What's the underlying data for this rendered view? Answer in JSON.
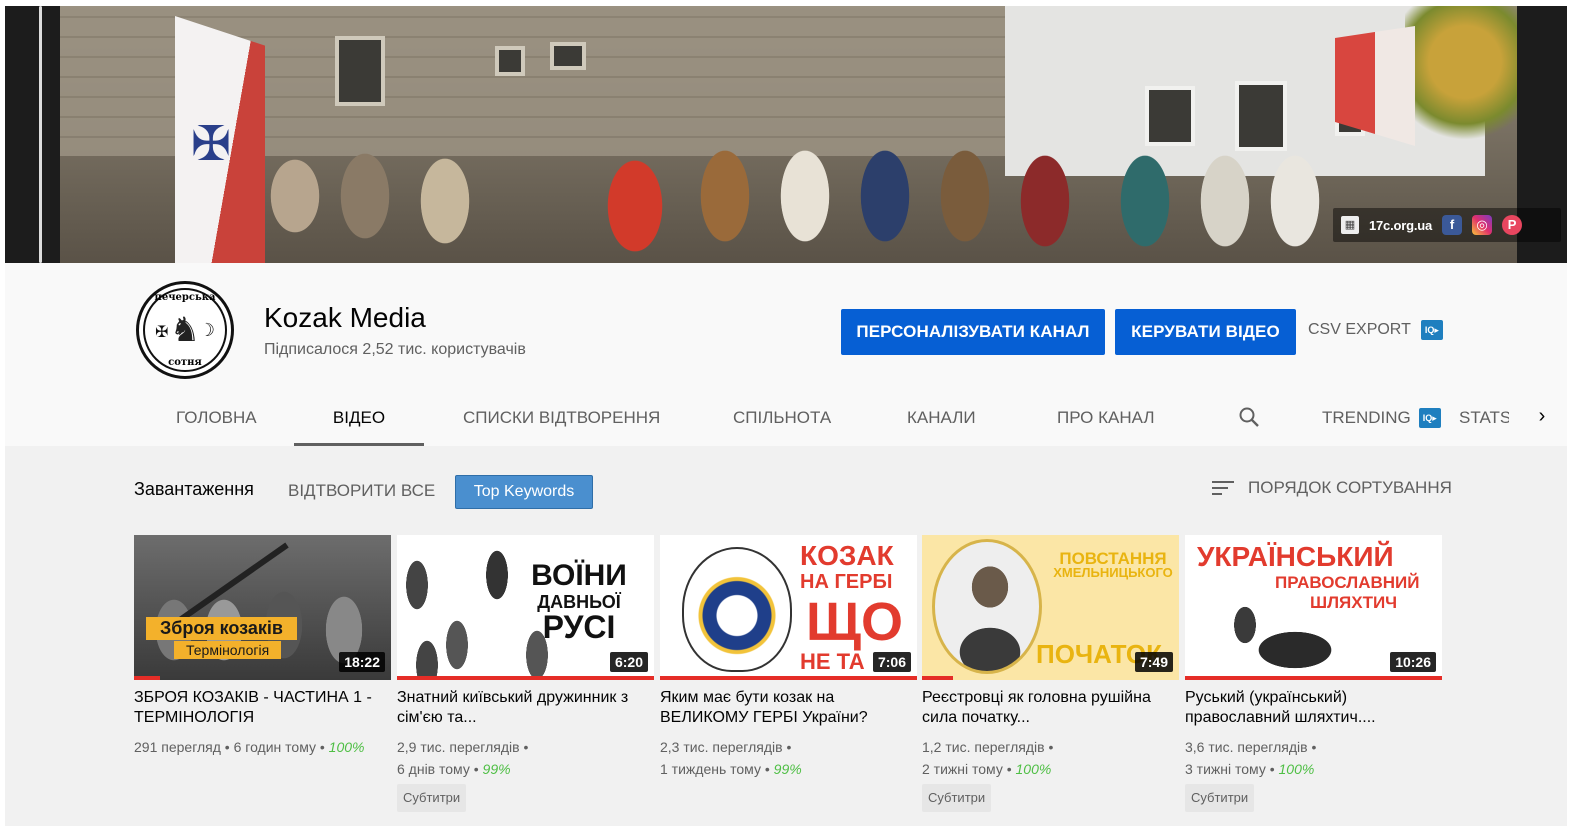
{
  "banner": {
    "site": "17c.org.ua"
  },
  "channel": {
    "name": "Kozak Media",
    "subscribers": "Підписалося 2,52 тис. користувачів",
    "avatar_top": "печерська",
    "avatar_bottom": "сотня"
  },
  "actions": {
    "personalize": "ПЕРСОНАЛІЗУВАТИ КАНАЛ",
    "manage": "КЕРУВАТИ ВІДЕО",
    "csv": "CSV EXPORT"
  },
  "tabs": [
    {
      "label": "ГОЛОВНА"
    },
    {
      "label": "ВІДЕО"
    },
    {
      "label": "СПИСКИ ВІДТВОРЕННЯ"
    },
    {
      "label": "СПІЛЬНОТА"
    },
    {
      "label": "КАНАЛИ"
    },
    {
      "label": "ПРО КАНАЛ"
    }
  ],
  "tabs_extra": {
    "trending": "TRENDING",
    "stats": "STATS"
  },
  "toolbar": {
    "uploads": "Завантаження",
    "play_all": "ВІДТВОРИТИ ВСЕ",
    "top_keywords": "Top Keywords",
    "sort": "ПОРЯДОК СОРТУВАННЯ"
  },
  "videos": [
    {
      "title": "ЗБРОЯ КОЗАКІВ - ЧАСТИНА 1 - ТЕРМІНОЛОГІЯ",
      "duration": "18:22",
      "views": "291 перегляд",
      "age": "6 годин тому",
      "pct": "100%",
      "thumb_line1": "Зброя козаків",
      "thumb_line2": "Термінологія"
    },
    {
      "title": "Знатний київський дружинник з сім'єю та...",
      "duration": "6:20",
      "views": "2,9 тис. переглядів",
      "age": "6 днів тому",
      "pct": "99%",
      "badge": "Субтитри",
      "thumb_line1": "ВОЇНИ",
      "thumb_line2": "ДАВНЬОЇ",
      "thumb_line3": "РУСІ"
    },
    {
      "title": "Яким має бути козак на ВЕЛИКОМУ ГЕРБІ України?",
      "duration": "7:06",
      "views": "2,3 тис. переглядів",
      "age": "1 тиждень тому",
      "pct": "99%",
      "thumb_line1": "КОЗАК",
      "thumb_line2": "НА ГЕРБІ",
      "thumb_line3": "ЩО",
      "thumb_line4": "НЕ ТА"
    },
    {
      "title": "Реєстровці як головна рушійна сила початку...",
      "duration": "7:49",
      "views": "1,2 тис. переглядів",
      "age": "2 тижні тому",
      "pct": "100%",
      "badge": "Субтитри",
      "thumb_line1": "ПОВСТАННЯ",
      "thumb_line2": "ХМЕЛЬНИЦЬКОГО",
      "thumb_line3": "ПОЧАТОК"
    },
    {
      "title": "Руський (український) православний шляхтич....",
      "duration": "10:26",
      "views": "3,6 тис. переглядів",
      "age": "3 тижні тому",
      "pct": "100%",
      "badge": "Субтитри",
      "thumb_line1": "УКРАЇНСЬКИЙ",
      "thumb_line2": "ПРАВОСЛАВНИЙ",
      "thumb_line3": "ШЛЯХТИЧ"
    }
  ],
  "colors": {
    "primary_button": "#065fd4",
    "progress": "#e52d27",
    "percent": "#4fbf45"
  }
}
